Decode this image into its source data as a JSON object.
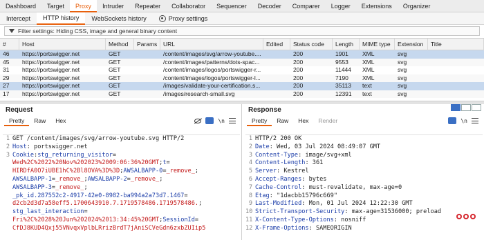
{
  "topnav": [
    "Dashboard",
    "Target",
    "Proxy",
    "Intruder",
    "Repeater",
    "Collaborator",
    "Sequencer",
    "Decoder",
    "Comparer",
    "Logger",
    "Extensions",
    "Organizer"
  ],
  "topnav_active": "Proxy",
  "subnav": {
    "intercept": "Intercept",
    "http_history": "HTTP history",
    "websockets": "WebSockets history",
    "proxy_settings": "Proxy settings"
  },
  "filter": "Filter settings: Hiding CSS, image and general binary content",
  "table": {
    "headers": [
      "#",
      "Host",
      "Method",
      "Params",
      "URL",
      "Edited",
      "Status code",
      "Length",
      "MIME type",
      "Extension",
      "Title"
    ],
    "rows": [
      [
        "46",
        "https://portswigger.net",
        "GET",
        "",
        "/content/images/svg/arrow-youtube....",
        "",
        "200",
        "1901",
        "XML",
        "svg",
        ""
      ],
      [
        "45",
        "https://portswigger.net",
        "GET",
        "",
        "/content/images/patterns/dots-spac...",
        "",
        "200",
        "9553",
        "XML",
        "svg",
        ""
      ],
      [
        "31",
        "https://portswigger.net",
        "GET",
        "",
        "/content/images/logos/portswigger-r...",
        "",
        "200",
        "11444",
        "XML",
        "svg",
        ""
      ],
      [
        "29",
        "https://portswigger.net",
        "GET",
        "",
        "/content/images/logos/portswigger-l...",
        "",
        "200",
        "7190",
        "XML",
        "svg",
        ""
      ],
      [
        "27",
        "https://portswigger.net",
        "GET",
        "",
        "/images/validate-your-certification.s...",
        "",
        "200",
        "35113",
        "text",
        "svg",
        ""
      ],
      [
        "17",
        "https://portswigger.net",
        "GET",
        "",
        "/images/research-small.svg",
        "",
        "200",
        "12391",
        "text",
        "svg",
        ""
      ]
    ]
  },
  "request": {
    "title": "Request",
    "tabs": [
      "Pretty",
      "Raw",
      "Hex"
    ],
    "lines": [
      {
        "n": "1",
        "segs": [
          [
            "txt",
            "GET /content/images/svg/arrow-youtube.svg HTTP/2"
          ]
        ]
      },
      {
        "n": "2",
        "segs": [
          [
            "key",
            "Host"
          ],
          [
            "txt",
            ": portswigger.net"
          ]
        ]
      },
      {
        "n": "3",
        "segs": [
          [
            "key",
            "Cookie"
          ],
          [
            "txt",
            ": "
          ],
          [
            "key",
            "stg_returning_visitor"
          ],
          [
            "txt",
            "="
          ]
        ]
      },
      {
        "n": "",
        "segs": [
          [
            "red",
            "Wed%2C%2022%20Nov%202023%2009:06:36%20GMT"
          ],
          [
            "txt",
            "; "
          ],
          [
            "key",
            "t"
          ],
          [
            "txt",
            "="
          ]
        ]
      },
      {
        "n": "",
        "segs": [
          [
            "red",
            "HIRDfA0O7iUBE1hC%2Bl8OVA%3D%3D"
          ],
          [
            "txt",
            "; "
          ],
          [
            "key",
            "AWSALBAPP-0"
          ],
          [
            "txt",
            "="
          ],
          [
            "red",
            "_remove_"
          ],
          [
            "txt",
            ";"
          ]
        ]
      },
      {
        "n": "",
        "segs": [
          [
            "key",
            "AWSALBAPP-1"
          ],
          [
            "txt",
            "="
          ],
          [
            "red",
            "_remove_"
          ],
          [
            "txt",
            "; "
          ],
          [
            "key",
            "AWSALBAPP-2"
          ],
          [
            "txt",
            "="
          ],
          [
            "red",
            "_remove_"
          ],
          [
            "txt",
            ";"
          ]
        ]
      },
      {
        "n": "",
        "segs": [
          [
            "key",
            "AWSALBAPP-3"
          ],
          [
            "txt",
            "="
          ],
          [
            "red",
            "_remove_"
          ],
          [
            "txt",
            ";"
          ]
        ]
      },
      {
        "n": "",
        "segs": [
          [
            "key",
            "_pk_id.287552c2-4917-42e0-8982-ba994a2a73d7.1467"
          ],
          [
            "txt",
            "="
          ]
        ]
      },
      {
        "n": "",
        "segs": [
          [
            "red",
            "d2cb2d3d7a58eff5.1700643910.7.1719578486.1719578486."
          ],
          [
            "txt",
            ";"
          ]
        ]
      },
      {
        "n": "",
        "segs": [
          [
            "key",
            "stg_last_interaction"
          ],
          [
            "txt",
            "="
          ]
        ]
      },
      {
        "n": "",
        "segs": [
          [
            "red",
            "Fri%2C%2028%20Jun%202024%2013:34:45%20GMT"
          ],
          [
            "txt",
            "; "
          ],
          [
            "key",
            "SessionId"
          ],
          [
            "txt",
            "="
          ]
        ]
      },
      {
        "n": "",
        "segs": [
          [
            "red",
            "CfDJ8KUD4Qxj55VNvqxVplbLRrizBrdT7jAniSCVeGdn6zxbZUIip5"
          ]
        ]
      }
    ]
  },
  "response": {
    "title": "Response",
    "tabs": [
      "Pretty",
      "Raw",
      "Hex",
      "Render"
    ],
    "lines": [
      {
        "n": "1",
        "segs": [
          [
            "txt",
            "HTTP/2 200 OK"
          ]
        ]
      },
      {
        "n": "2",
        "segs": [
          [
            "key",
            "Date"
          ],
          [
            "txt",
            ": Wed, 03 Jul 2024 08:49:07 GMT"
          ]
        ]
      },
      {
        "n": "3",
        "segs": [
          [
            "key",
            "Content-Type"
          ],
          [
            "txt",
            ": image/svg+xml"
          ]
        ]
      },
      {
        "n": "4",
        "segs": [
          [
            "key",
            "Content-Length"
          ],
          [
            "txt",
            ": 361"
          ]
        ]
      },
      {
        "n": "5",
        "segs": [
          [
            "key",
            "Server"
          ],
          [
            "txt",
            ": Kestrel"
          ]
        ]
      },
      {
        "n": "6",
        "segs": [
          [
            "key",
            "Accept-Ranges"
          ],
          [
            "txt",
            ": bytes"
          ]
        ]
      },
      {
        "n": "7",
        "segs": [
          [
            "key",
            "Cache-Control"
          ],
          [
            "txt",
            ": must-revalidate, max-age=0"
          ]
        ]
      },
      {
        "n": "8",
        "segs": [
          [
            "key",
            "Etag"
          ],
          [
            "txt",
            ": \"1dacbb15796c669\""
          ]
        ]
      },
      {
        "n": "9",
        "segs": [
          [
            "key",
            "Last-Modified"
          ],
          [
            "txt",
            ": Mon, 01 Jul 2024 12:22:30 GMT"
          ]
        ]
      },
      {
        "n": "10",
        "segs": [
          [
            "key",
            "Strict-Transport-Security"
          ],
          [
            "txt",
            ": max-age=31536000; preload"
          ]
        ]
      },
      {
        "n": "11",
        "segs": [
          [
            "key",
            "X-Content-Type-Options"
          ],
          [
            "txt",
            ": nosniff"
          ]
        ]
      },
      {
        "n": "12",
        "segs": [
          [
            "key",
            "X-Frame-Options"
          ],
          [
            "txt",
            ": SAMEORIGIN"
          ]
        ]
      }
    ]
  },
  "colors": {
    "accent": "#e8600c",
    "selected_row": "#c6d8ee",
    "header_key": "#1a3ca8",
    "value_red": "#c41a1a"
  }
}
